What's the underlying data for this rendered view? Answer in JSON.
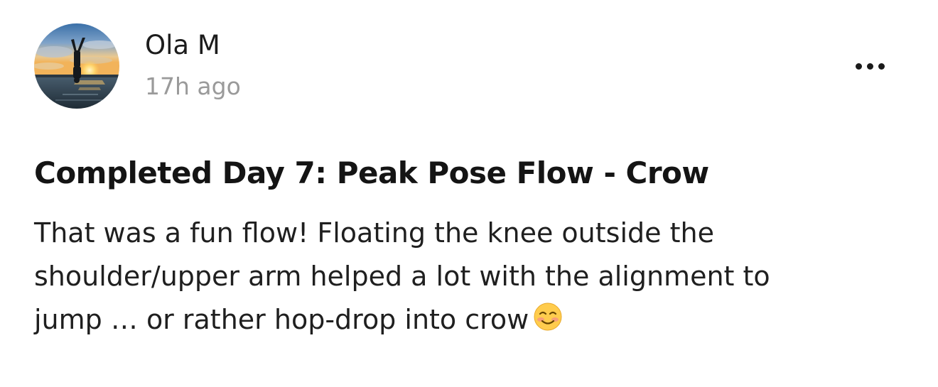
{
  "author": {
    "name": "Ola M",
    "timestamp": "17h ago",
    "avatar_icon": "yoga-headstand-sunset-photo"
  },
  "actions": {
    "more_icon": "more-horizontal-icon"
  },
  "post": {
    "title": "Completed Day 7: Peak Pose Flow - Crow",
    "body_lines": [
      "That was a fun flow! Floating the knee outside the",
      "shoulder/upper arm helped a lot with the alignment to",
      "jump … or rather hop-drop into crow"
    ],
    "emoji": "☺️",
    "emoji_icon": "smiling-face-emoji"
  }
}
